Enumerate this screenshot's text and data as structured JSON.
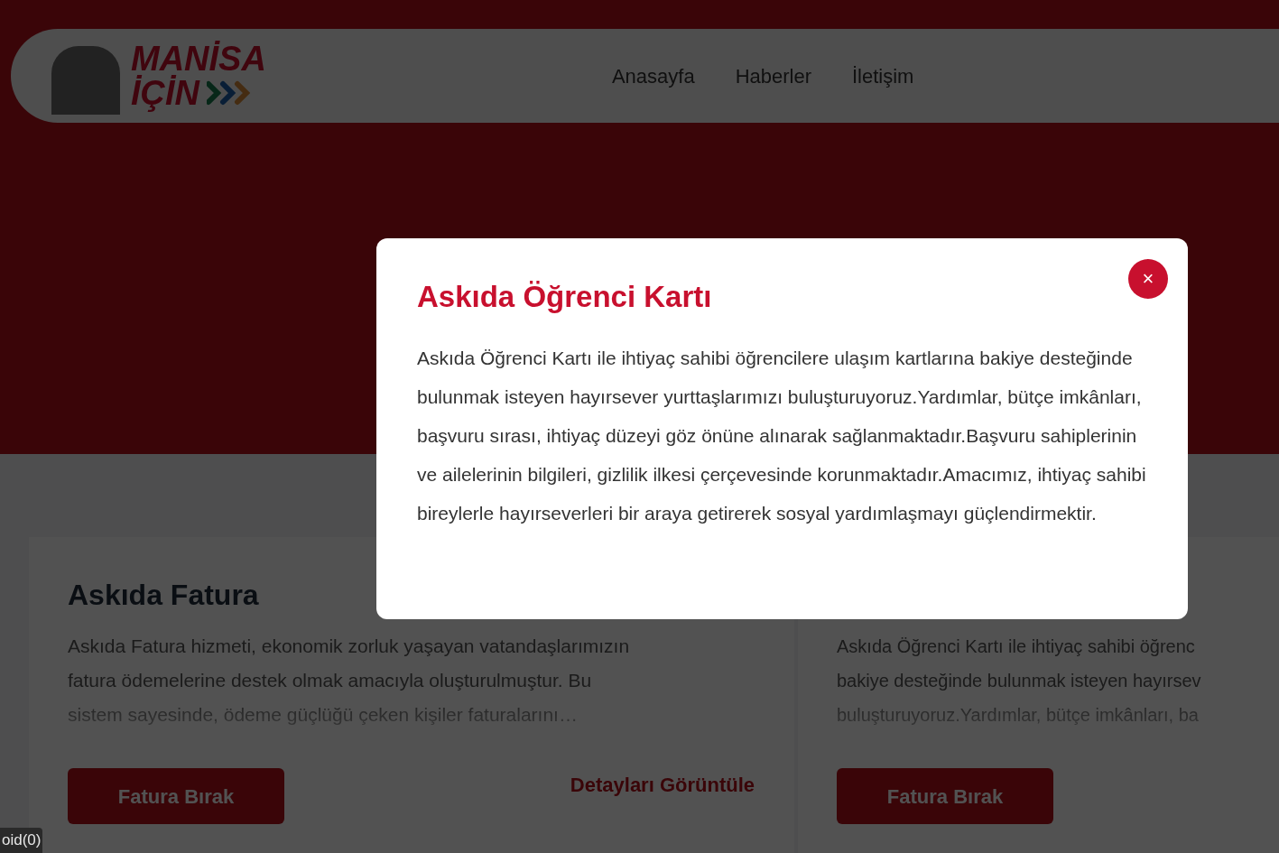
{
  "header": {
    "logo": {
      "line_1": "MANİSA",
      "line_2": "İÇİN"
    },
    "nav": [
      {
        "label": "Anasayfa"
      },
      {
        "label": "Haberler"
      },
      {
        "label": "İletişim"
      }
    ]
  },
  "cards": [
    {
      "title": "Askıda Fatura",
      "description": [
        "Askıda Fatura hizmeti, ekonomik zorluk yaşayan vatandaşlarımızın",
        "fatura ödemelerine destek olmak amacıyla oluşturulmuştur. Bu",
        "sistem sayesinde, ödeme güçlüğü çeken kişiler faturalarını…"
      ],
      "button": "Fatura Bırak",
      "link": "Detayları Görüntüle"
    },
    {
      "description": [
        "Askıda Öğrenci Kartı ile ihtiyaç sahibi öğrenc",
        "bakiye desteğinde bulunmak isteyen hayırsev",
        "buluşturuyoruz.Yardımlar, bütçe imkânları, ba"
      ],
      "button": "Fatura Bırak"
    }
  ],
  "modal": {
    "title": "Askıda Öğrenci Kartı",
    "close": "×",
    "body": "Askıda Öğrenci Kartı ile ihtiyaç sahibi öğrencilere ulaşım kartlarına bakiye desteğinde bulunmak isteyen hayırsever yurttaşlarımızı buluşturuyoruz.Yardımlar, bütçe imkânları, başvuru sırası, ihtiyaç düzeyi göz önüne alınarak sağlanmaktadır.Başvuru sahiplerinin ve ailelerinin bilgileri, gizlilik ilkesi çerçevesinde korunmaktadır.Amacımız, ihtiyaç sahibi bireylerle hayırseverleri bir araya getirerek sosyal yardımlaşmayı güçlendirmektir."
  },
  "status_bar": {
    "text": "oid(0)"
  }
}
